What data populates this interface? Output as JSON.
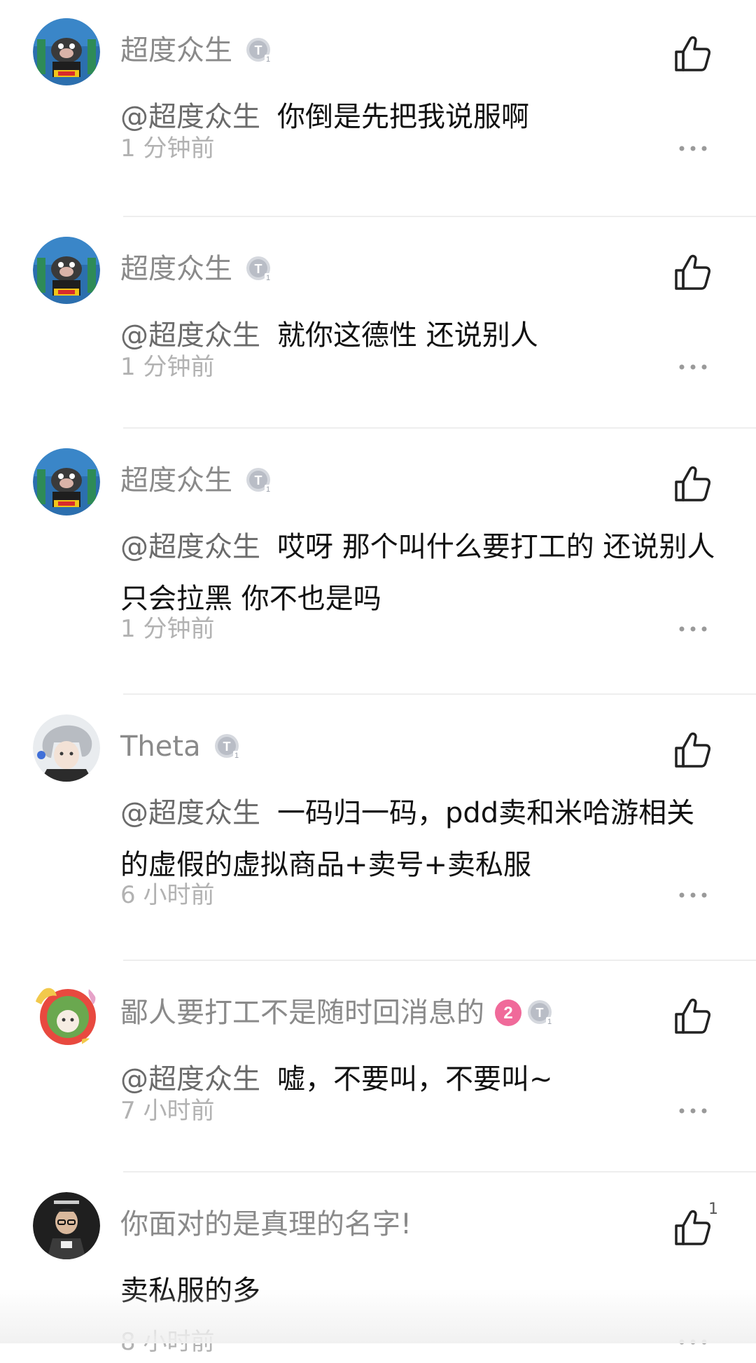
{
  "comments": [
    {
      "username": "超度众生",
      "mention": "@超度众生",
      "text": "你倒是先把我说服啊",
      "time": "1 分钟前",
      "avatar_icon": "pig-avatar-icon",
      "badge_icon": "silver-level-badge-icon"
    },
    {
      "username": "超度众生",
      "mention": "@超度众生",
      "text": "就你这德性 还说别人",
      "time": "1 分钟前",
      "avatar_icon": "pig-avatar-icon",
      "badge_icon": "silver-level-badge-icon"
    },
    {
      "username": "超度众生",
      "mention": "@超度众生",
      "text": "哎呀 那个叫什么要打工的 还说别人只会拉黑 你不也是吗",
      "time": "1 分钟前",
      "avatar_icon": "pig-avatar-icon",
      "badge_icon": "silver-level-badge-icon"
    },
    {
      "username": "Theta",
      "mention": "@超度众生",
      "text": "一码归一码，pdd卖和米哈游相关的虚假的虚拟商品+卖号+卖私服",
      "time": "6 小时前",
      "avatar_icon": "anime-character-avatar-icon",
      "badge_icon": "silver-level-badge-icon"
    },
    {
      "username": "鄙人要打工不是随时回消息的",
      "mention": "@超度众生",
      "text": "嘘，不要叫，不要叫~",
      "time": "7 小时前",
      "avatar_icon": "anime-girl-avatar-icon",
      "level_number": "2",
      "badge_icon": "silver-level-badge-icon"
    },
    {
      "username": "你面对的是真理的名字!",
      "mention": "",
      "text": "卖私服的多",
      "time": "8 小时前",
      "like_count": "1",
      "avatar_icon": "teacher-avatar-icon",
      "badge_icon": ""
    }
  ],
  "colors": {
    "username": "#8a8a8a",
    "mention": "#6b6b6b",
    "text": "#111111",
    "time": "#b2b2b2",
    "level_pink": "#f06a9a",
    "divider": "#eeeeee"
  }
}
